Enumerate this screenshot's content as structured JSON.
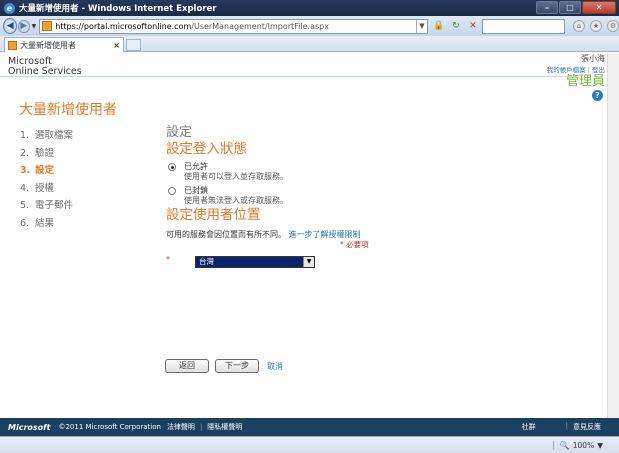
{
  "window": {
    "title": "大量新增使用者 - Windows Internet Explorer"
  },
  "address": {
    "https": "https://",
    "host": "portal.microsoftonline.com",
    "path": "/UserManagement/ImportFile.aspx"
  },
  "tab": {
    "label": "大量新增使用者"
  },
  "header": {
    "logo_line1": "Microsoft",
    "logo_line2": "Online Services",
    "user_name": "張小海",
    "link_profile": "我的帳戶檔案",
    "link_sep": "|",
    "link_signout": "登出",
    "admin": "管理員"
  },
  "page": {
    "title": "大量新增使用者"
  },
  "steps": [
    {
      "num": "1.",
      "label": "選取檔案"
    },
    {
      "num": "2.",
      "label": "驗證"
    },
    {
      "num": "3.",
      "label": "設定"
    },
    {
      "num": "4.",
      "label": "授權"
    },
    {
      "num": "5.",
      "label": "電子郵件"
    },
    {
      "num": "6.",
      "label": "結果"
    }
  ],
  "content": {
    "section_main": "設定",
    "signin_title": "設定登入狀態",
    "allowed_label": "已允許",
    "allowed_desc": "使用者可以登入並存取服務。",
    "blocked_label": "已封鎖",
    "blocked_desc": "使用者無法登入或存取服務。",
    "location_title": "設定使用者位置",
    "location_desc": "可用的服務會因位置而有所不同。",
    "location_link": "進一步了解授權限制",
    "required_note": "* 必要項",
    "required_star": "*",
    "country_value": "台灣"
  },
  "buttons": {
    "back": "返回",
    "next": "下一步",
    "cancel": "取消"
  },
  "footer": {
    "logo": "Microsoft",
    "copyright": "©2011 Microsoft Corporation",
    "legal": "法律聲明",
    "sep": "|",
    "privacy": "隱私權聲明",
    "community": "社群",
    "feedback": "意見反應"
  },
  "status": {
    "zoom": "100%"
  }
}
